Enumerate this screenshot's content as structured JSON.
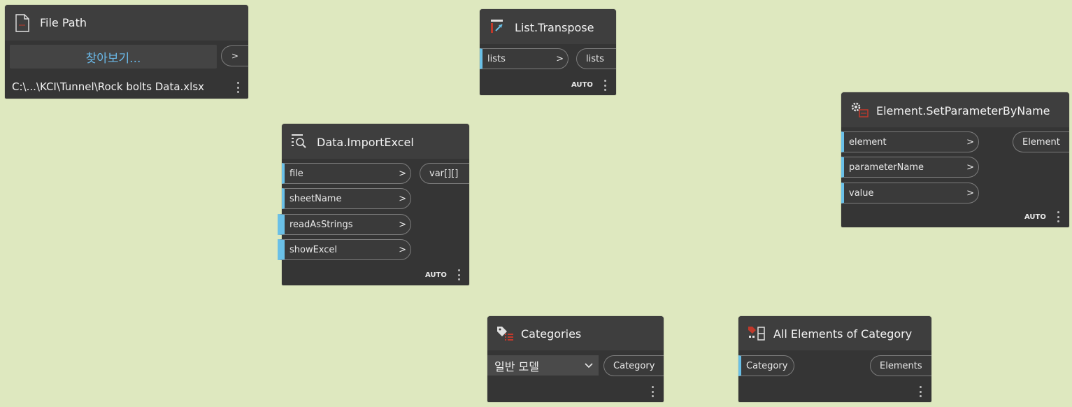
{
  "colors": {
    "canvas": "#dee8bf",
    "node_body": "#353535",
    "node_header": "#3e3e3e",
    "port_accent": "#6ac0e7",
    "browse_text": "#6ab8e7"
  },
  "nodes": {
    "file_path": {
      "title": "File Path",
      "icon": "file-icon",
      "browse_label": "찾아보기...",
      "output_label": ">",
      "path": "C:\\...\\KCI\\Tunnel\\Rock bolts Data.xlsx"
    },
    "list_transpose": {
      "title": "List.Transpose",
      "icon": "transpose-icon",
      "inputs": [
        {
          "label": "lists",
          "arrow": ">"
        }
      ],
      "outputs": [
        {
          "label": "lists"
        }
      ],
      "lacing": "AUTO"
    },
    "import_excel": {
      "title": "Data.ImportExcel",
      "icon": "import-excel-icon",
      "inputs": [
        {
          "label": "file",
          "arrow": ">"
        },
        {
          "label": "sheetName",
          "arrow": ">"
        },
        {
          "label": "readAsStrings",
          "arrow": ">"
        },
        {
          "label": "showExcel",
          "arrow": ">"
        }
      ],
      "outputs": [
        {
          "label": "var[][]"
        }
      ],
      "lacing": "AUTO"
    },
    "set_parameter": {
      "title": "Element.SetParameterByName",
      "icon": "set-parameter-icon",
      "inputs": [
        {
          "label": "element",
          "arrow": ">"
        },
        {
          "label": "parameterName",
          "arrow": ">"
        },
        {
          "label": "value",
          "arrow": ">"
        }
      ],
      "outputs": [
        {
          "label": "Element"
        }
      ],
      "lacing": "AUTO"
    },
    "categories": {
      "title": "Categories",
      "icon": "categories-icon",
      "selected": "일반 모델",
      "outputs": [
        {
          "label": "Category"
        }
      ]
    },
    "all_elements": {
      "title": "All Elements of Category",
      "icon": "all-elements-icon",
      "inputs": [
        {
          "label": "Category"
        }
      ],
      "outputs": [
        {
          "label": "Elements"
        }
      ]
    }
  }
}
